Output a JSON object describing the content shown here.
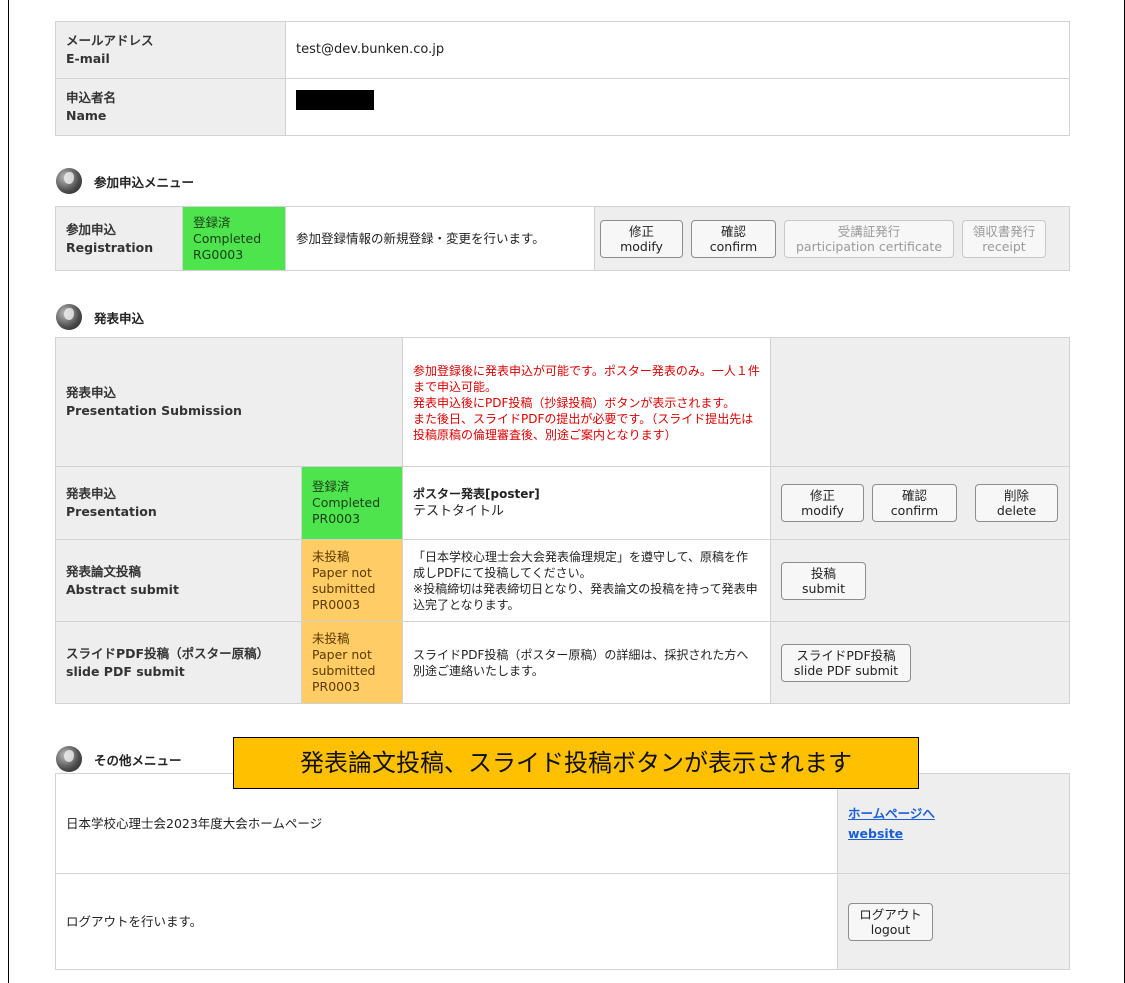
{
  "account": {
    "email_label_ja": "メールアドレス",
    "email_label_en": "E-mail",
    "email_value": "test@dev.bunken.co.jp",
    "name_label_ja": "申込者名",
    "name_label_en": "Name"
  },
  "registration_section": {
    "title": "参加申込メニュー",
    "label_ja": "参加申込",
    "label_en": "Registration",
    "status_ja": "登録済",
    "status_en": "Completed",
    "status_id": "RG0003",
    "description": "参加登録情報の新規登録・変更を行います。",
    "buttons": {
      "modify_ja": "修正",
      "modify_en": "modify",
      "confirm_ja": "確認",
      "confirm_en": "confirm",
      "certificate_ja": "受講証発行",
      "certificate_en": "participation certificate",
      "receipt_ja": "領収書発行",
      "receipt_en": "receipt"
    }
  },
  "presentation_section": {
    "title": "発表申込",
    "header_label_ja": "発表申込",
    "header_label_en": "Presentation Submission",
    "notice": "参加登録後に発表申込が可能です。ポスター発表のみ。一人１件まで申込可能。\n発表申込後にPDF投稿（抄録投稿）ボタンが表示されます。\nまた後日、スライドPDFの提出が必要です。（スライド提出先は投稿原稿の倫理審査後、別途ご案内となります）",
    "rows": [
      {
        "label_ja": "発表申込",
        "label_en": "Presentation",
        "status_ja": "登録済",
        "status_en": "Completed",
        "status_id": "PR0003",
        "type": "ポスター発表[poster]",
        "title": "テストタイトル",
        "buttons": {
          "modify_ja": "修正",
          "modify_en": "modify",
          "confirm_ja": "確認",
          "confirm_en": "confirm",
          "delete_ja": "削除",
          "delete_en": "delete"
        }
      },
      {
        "label_ja": "発表論文投稿",
        "label_en": "Abstract submit",
        "status_ja": "未投稿",
        "status_en1": "Paper not",
        "status_en2": "submitted",
        "status_id": "PR0003",
        "description": "「日本学校心理士会大会発表倫理規定」を遵守して、原稿を作成しPDFにて投稿してください。\n※投稿締切は発表締切日となり、発表論文の投稿を持って発表申込完了となります。",
        "button_ja": "投稿",
        "button_en": "submit"
      },
      {
        "label_ja": "スライドPDF投稿（ポスター原稿）",
        "label_en": "slide PDF submit",
        "status_ja": "未投稿",
        "status_en1": "Paper not",
        "status_en2": "submitted",
        "status_id": "PR0003",
        "description": "スライドPDF投稿（ポスター原稿）の詳細は、採択された方へ別途ご連絡いたします。",
        "button_ja": "スライドPDF投稿",
        "button_en": "slide PDF submit"
      }
    ]
  },
  "other_section": {
    "title": "その他メニュー",
    "homepage_text": "日本学校心理士会2023年度大会ホームページ",
    "homepage_link_ja": "ホームページへ",
    "homepage_link_en": "website",
    "logout_text": "ログアウトを行います。",
    "logout_ja": "ログアウト",
    "logout_en": "logout"
  },
  "callout_text": "発表論文投稿、スライド投稿ボタンが表示されます",
  "colors": {
    "completed": "#4ee44e",
    "not_submitted": "#ffcc66",
    "notice_red": "#dd0000",
    "callout": "#ffc000",
    "link": "#1a5fd6"
  }
}
